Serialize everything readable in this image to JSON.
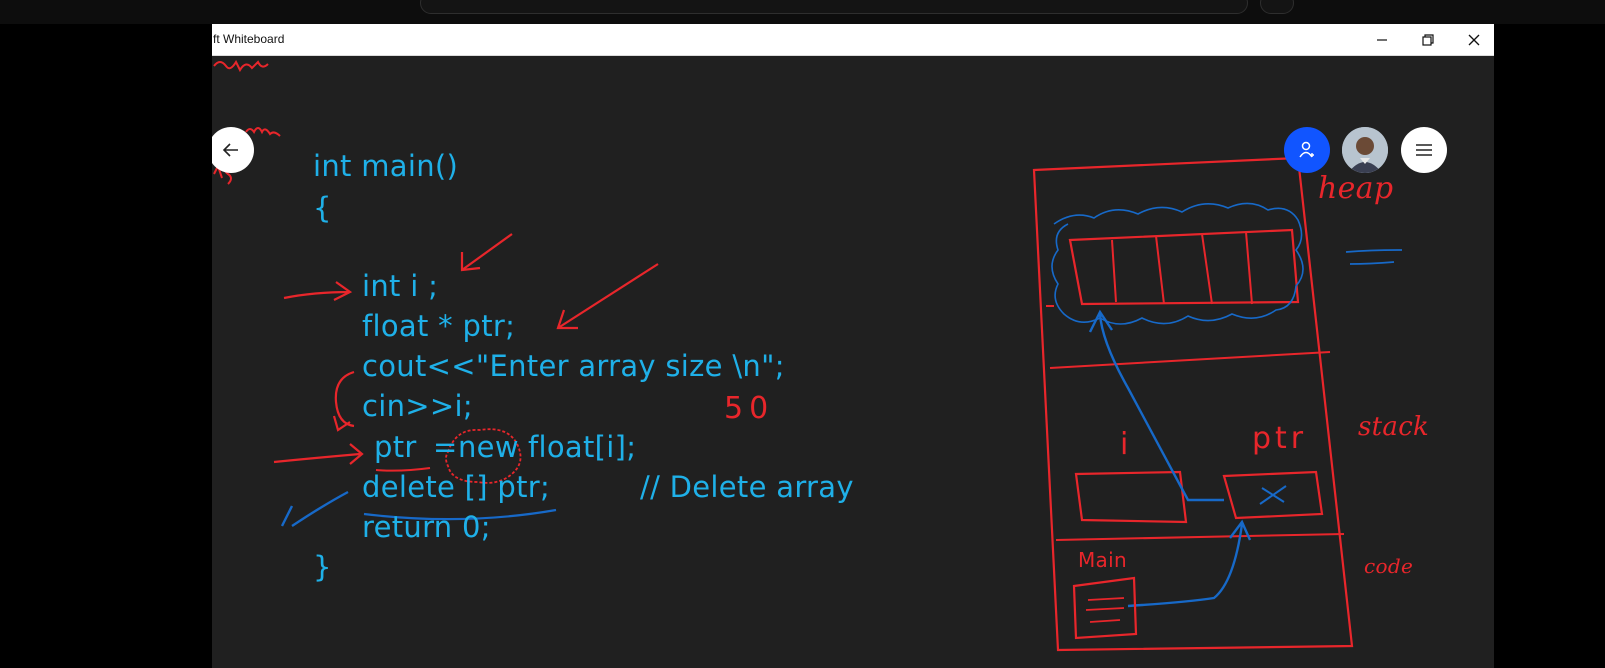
{
  "window": {
    "title": "ft Whiteboard"
  },
  "controls": {
    "minimize_icon": "minimize-icon",
    "restore_icon": "restore-icon",
    "close_icon": "close-icon"
  },
  "toolbar": {
    "back_icon": "arrow-left-icon",
    "invite_icon": "add-person-icon",
    "menu_icon": "hamburger-menu-icon"
  },
  "code": {
    "line1": "int main()",
    "line2": "{",
    "line3": "int i ;",
    "line4": "float * ptr;",
    "line5": "cout<<\"Enter array size \\n\";",
    "line6": "cin>>i;",
    "line7a": "ptr",
    "line7b": "=",
    "line7c": "new",
    "line7d": "float[i];",
    "line8": "delete [] ptr;",
    "line8_comment": "// Delete array",
    "line9": "return 0;",
    "line10": "}"
  },
  "annotations": {
    "input_value": "50",
    "diagram_heap": "heap",
    "diagram_stack": "stack",
    "diagram_code": "code",
    "diagram_var_i": "i",
    "diagram_var_ptr": "ptr",
    "diagram_main": "Main",
    "margin_note_1": "hat all",
    "margin_note_2": "ien",
    "margin_note_3": "ds"
  },
  "colors": {
    "ink_blue": "#1fb0e8",
    "ink_red": "#e8262b",
    "ink_dark_blue": "#1769c8",
    "canvas": "#202020",
    "invite_button": "#1155ff"
  }
}
